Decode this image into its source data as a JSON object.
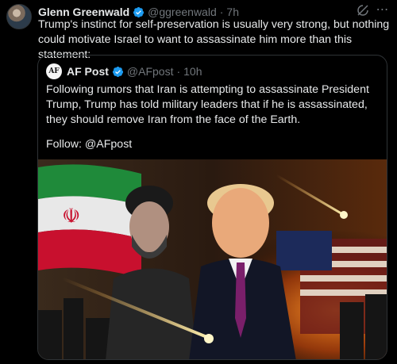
{
  "tweet": {
    "author_name": "Glenn Greenwald",
    "author_handle": "@ggreenwald",
    "separator": "·",
    "time": "7h",
    "text": "Trump's instinct for self-preservation is usually very strong, but nothing could motivate Israel to want to assassinate him more than this statement:"
  },
  "quote": {
    "avatar_text": "AF",
    "author_name": "AF Post",
    "author_handle": "@AFpost",
    "separator": "·",
    "time": "10h",
    "text": "Following rumors that Iran is attempting to assassinate President Trump, Trump has told military leaders that if he is assassinated, they should remove Iran from the face of the Earth.",
    "follow": "Follow: @AFpost"
  },
  "icons": {
    "verified": "verified-badge-icon",
    "grok": "grok-icon",
    "more": "more-options-icon"
  },
  "colors": {
    "background": "#000000",
    "text": "#e7e9ea",
    "muted": "#71767b",
    "verified_blue": "#1d9bf0",
    "border": "#2f3336"
  }
}
